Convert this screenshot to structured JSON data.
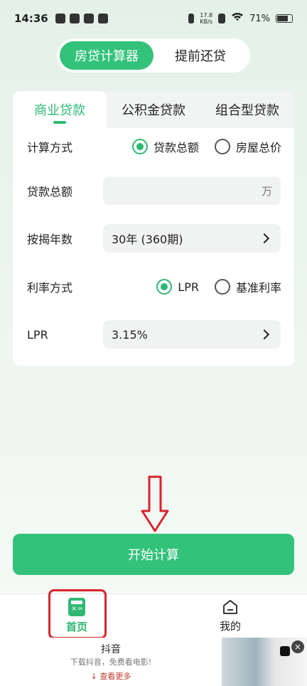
{
  "status_bar": {
    "time": "14:36",
    "net_speed_value": "17.8",
    "net_speed_unit": "KB/s",
    "battery": "71%"
  },
  "top_switch": {
    "calculator_label": "房贷计算器",
    "prepay_label": "提前还贷"
  },
  "tabs": {
    "commercial": "商业贷款",
    "provident": "公积金贷款",
    "combined": "组合型贷款"
  },
  "form": {
    "calc_method_label": "计算方式",
    "calc_option_total_loan": "贷款总额",
    "calc_option_house_price": "房屋总价",
    "loan_amount_label": "贷款总额",
    "loan_amount_unit": "万",
    "term_label": "按揭年数",
    "term_value": "30年 (360期)",
    "rate_method_label": "利率方式",
    "rate_option_lpr": "LPR",
    "rate_option_base": "基准利率",
    "lpr_label": "LPR",
    "lpr_value": "3.15%"
  },
  "actions": {
    "start_label": "开始计算"
  },
  "bottom_nav": {
    "home_label": "首页",
    "mine_label": "我的"
  },
  "ad": {
    "title": "抖音",
    "desc": "下载抖音，免费看电影!",
    "more": "查看更多"
  },
  "colors": {
    "accent": "#33c27a",
    "annotation_red": "#d9242b"
  }
}
